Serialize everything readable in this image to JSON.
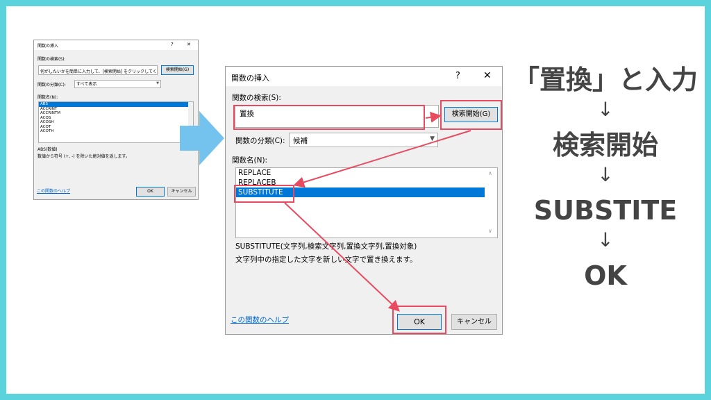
{
  "small_dialog": {
    "title": "関数の挿入",
    "help_glyph": "?",
    "close_glyph": "✕",
    "search_label": "関数の検索(S):",
    "search_value": "何がしたいかを簡単に入力して、[検索開始] をクリックしてください。",
    "search_button": "検索開始(G)",
    "category_label": "関数の分類(C):",
    "category_value": "すべて表示",
    "function_label": "関数名(N):",
    "functions": [
      "ABS",
      "ACCRINT",
      "ACCRINTM",
      "ACOS",
      "ACOSH",
      "ACOT",
      "ACOTH"
    ],
    "syntax": "ABS(数値)",
    "description": "数値から符号 (+, -) を除いた絶対値を返します。",
    "help_link": "この関数のヘルプ",
    "ok_button": "OK",
    "cancel_button": "キャンセル"
  },
  "big_dialog": {
    "title": "関数の挿入",
    "help_glyph": "?",
    "close_glyph": "✕",
    "search_label": "関数の検索(S):",
    "search_value": "置換",
    "search_button": "検索開始(G)",
    "category_label": "関数の分類(C):",
    "category_value": "候補",
    "function_label": "関数名(N):",
    "functions": [
      "REPLACE",
      "REPLACEB",
      "SUBSTITUTE"
    ],
    "syntax": "SUBSTITUTE(文字列,検索文字列,置換文字列,置換対象)",
    "description": "文字列中の指定した文字を新しい文字で置き換えます。",
    "help_link": "この関数のヘルプ",
    "ok_button": "OK",
    "cancel_button": "キャンセル"
  },
  "steps": {
    "step1": "「置換」と入力",
    "step2": "検索開始",
    "step3": "SUBSTITE",
    "step4": "OK",
    "arrow": "↓"
  },
  "colors": {
    "background": "#5ad3dd",
    "card": "#ffffff",
    "highlight_red": "#e84a5f",
    "arrow_blue": "#74c2ee",
    "selection_blue": "#0078d7"
  }
}
